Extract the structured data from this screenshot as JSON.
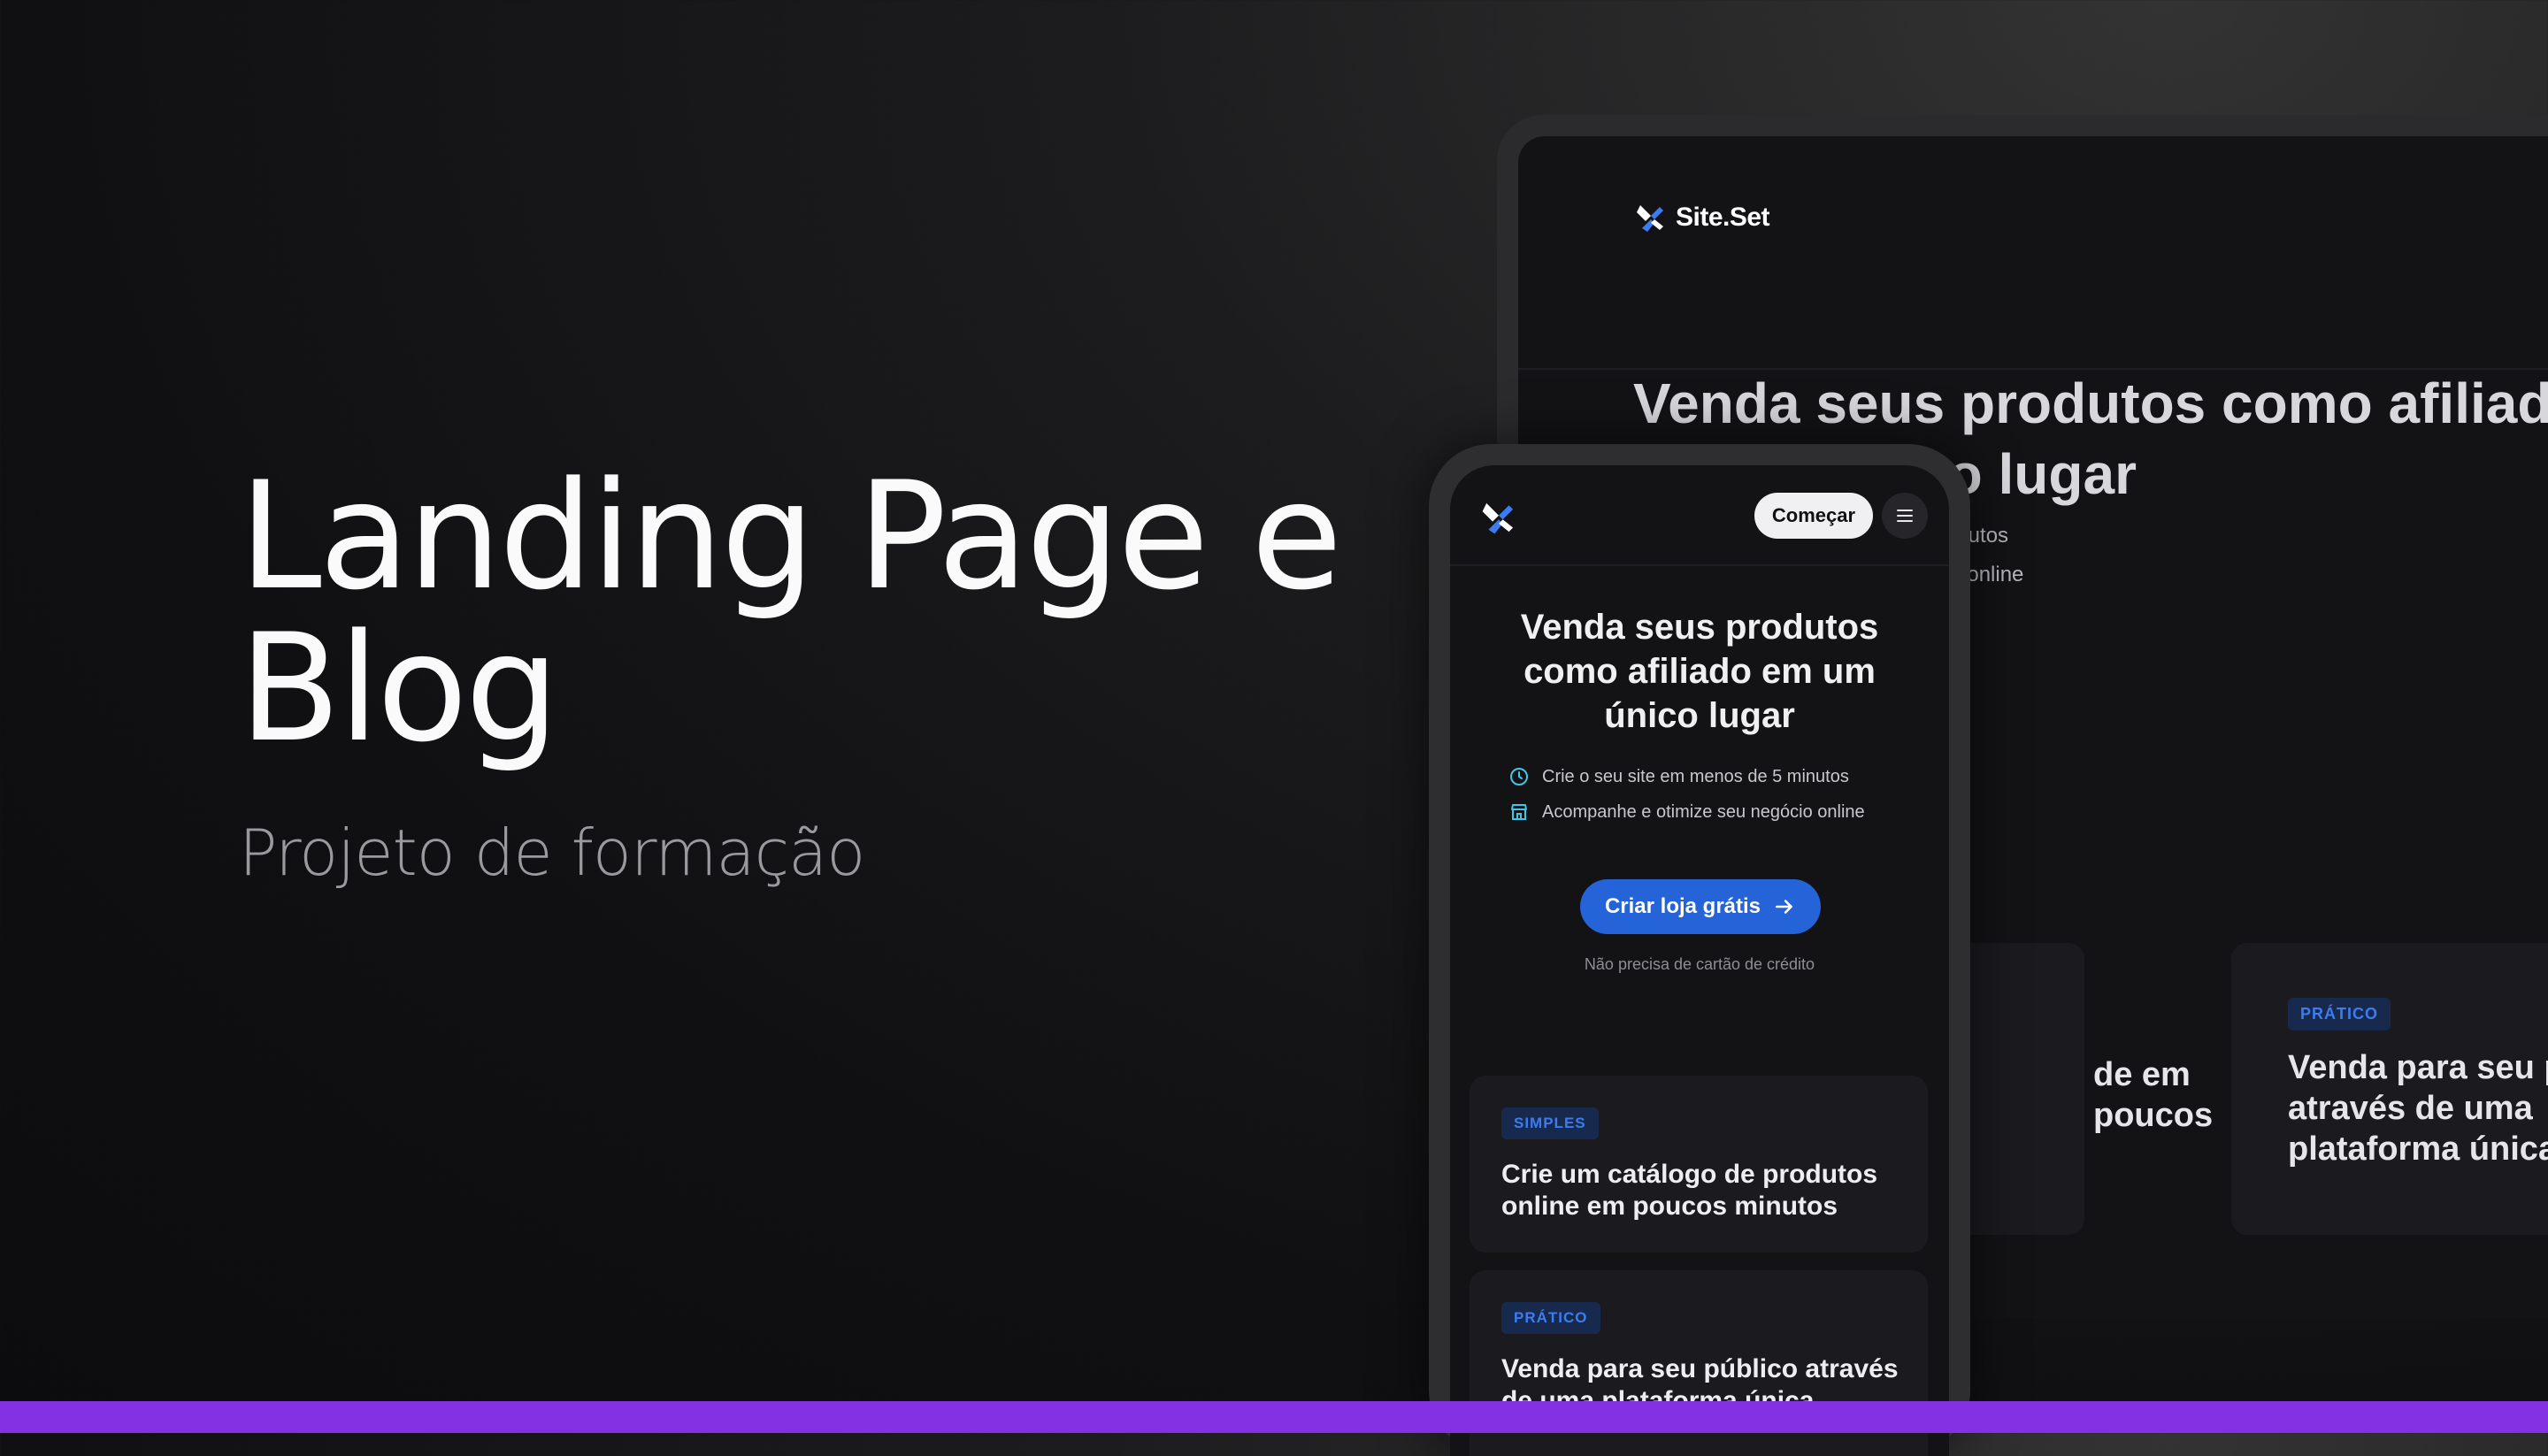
{
  "hero": {
    "title_line1": "Landing Page e",
    "title_line2": "Blog",
    "subtitle": "Projeto de formação"
  },
  "desktop": {
    "logo_text": "Site.Set",
    "headline": "Venda seus produtos como afiliado em um único lugar",
    "feature1_fragment": "minutos",
    "feature2_fragment": "cio online",
    "card1": {
      "text": "de em poucos"
    },
    "card2": {
      "badge": "PRÁTICO",
      "text": "Venda para seu público através de uma plataforma única"
    }
  },
  "phone": {
    "start_button": "Começar",
    "headline": "Venda seus produtos como afiliado em um único lugar",
    "feature1": "Crie o seu site em menos de 5 minutos",
    "feature2": "Acompanhe e otimize seu negócio online",
    "cta_label": "Criar loja grátis",
    "cta_note": "Não precisa de cartão de crédito",
    "card1": {
      "badge": "SIMPLES",
      "text": "Crie um catálogo de produtos online em poucos minutos"
    },
    "card2": {
      "badge": "PRÁTICO",
      "text": "Venda para seu público através de uma plataforma única"
    }
  },
  "colors": {
    "accent": "#2563d8",
    "bottom_bar": "#8431e4",
    "feature_icon": "#3ec6e6"
  },
  "icons": [
    "site-set-logo-icon",
    "menu-icon",
    "clock-icon",
    "store-icon",
    "arrow-right-icon"
  ]
}
